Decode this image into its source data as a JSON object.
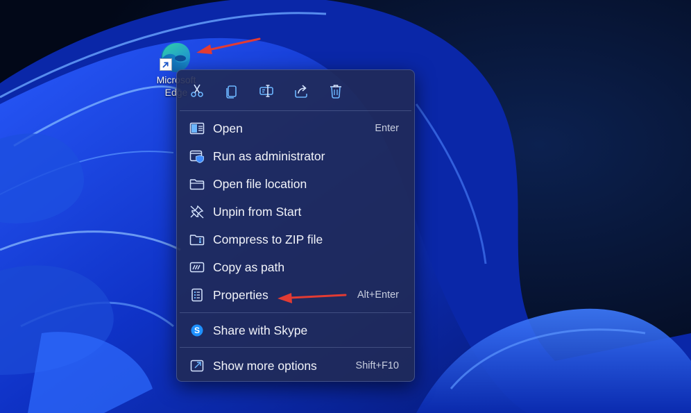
{
  "desktop": {
    "icon": {
      "name": "edge-icon",
      "label": "Microsoft Edge"
    }
  },
  "context_menu": {
    "toolbar": [
      {
        "name": "cut-icon"
      },
      {
        "name": "copy-icon"
      },
      {
        "name": "rename-icon"
      },
      {
        "name": "share-icon"
      },
      {
        "name": "delete-icon"
      }
    ],
    "items": [
      {
        "label": "Open",
        "shortcut": "Enter",
        "icon": "open-icon"
      },
      {
        "label": "Run as administrator",
        "shortcut": "",
        "icon": "shield-icon"
      },
      {
        "label": "Open file location",
        "shortcut": "",
        "icon": "folder-icon"
      },
      {
        "label": "Unpin from Start",
        "shortcut": "",
        "icon": "unpin-icon"
      },
      {
        "label": "Compress to ZIP file",
        "shortcut": "",
        "icon": "zip-folder-icon"
      },
      {
        "label": "Copy as path",
        "shortcut": "",
        "icon": "path-icon"
      },
      {
        "label": "Properties",
        "shortcut": "Alt+Enter",
        "icon": "properties-icon"
      },
      {
        "label": "Share with Skype",
        "shortcut": "",
        "icon": "skype-icon"
      },
      {
        "label": "Show more options",
        "shortcut": "Shift+F10",
        "icon": "more-options-icon"
      }
    ]
  },
  "colors": {
    "menu_bg": "#202a56",
    "accent": "#4ba3ff",
    "annotation_arrow": "#e23b33"
  }
}
